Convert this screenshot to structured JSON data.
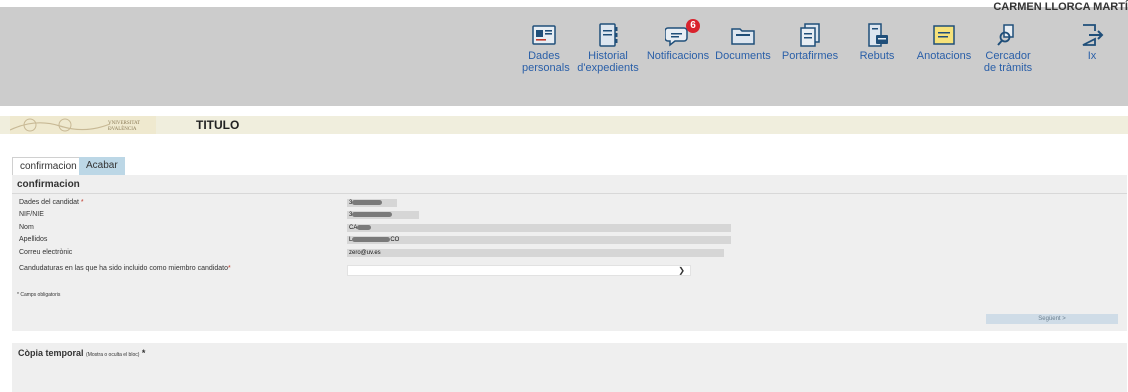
{
  "header": {
    "user_name": "CARMEN LLORCA MARTÍ",
    "nav": [
      {
        "key": "dades",
        "label1": "Dades",
        "label2": "personals",
        "icon": "id-card-icon"
      },
      {
        "key": "historial",
        "label1": "Historial",
        "label2": "d'expedients",
        "icon": "notebook-icon"
      },
      {
        "key": "notificacions",
        "label1": "Notificacions",
        "label2": "",
        "icon": "chat-bubble-icon",
        "badge": "6"
      },
      {
        "key": "documents",
        "label1": "Documents",
        "label2": "",
        "icon": "folder-icon"
      },
      {
        "key": "portafirmes",
        "label1": "Portafirmes",
        "label2": "",
        "icon": "document-stack-icon"
      },
      {
        "key": "rebuts",
        "label1": "Rebuts",
        "label2": "",
        "icon": "receipt-icon"
      },
      {
        "key": "anotacions",
        "label1": "Anotacions",
        "label2": "",
        "icon": "note-icon"
      },
      {
        "key": "cercador",
        "label1": "Cercador",
        "label2": "de tràmits",
        "icon": "search-document-icon"
      },
      {
        "key": "ix",
        "label1": "Ix",
        "label2": "",
        "icon": "exit-icon"
      }
    ]
  },
  "titlebar": {
    "logo_text": "UNIVERSITAT DE VALÈNCIA",
    "title": "TITULO"
  },
  "tabs": [
    {
      "label": "confirmacion"
    },
    {
      "label": "Acabar"
    }
  ],
  "form": {
    "section_title": "confirmacion",
    "fields": [
      {
        "label": "Dades del candidat",
        "required_mark": "*",
        "value": "3"
      },
      {
        "label": "NIF/NIE",
        "value": "3"
      },
      {
        "label": "Nom",
        "value": "CA"
      },
      {
        "label": "Apellidos",
        "value": "L",
        "value_tail": "CO"
      },
      {
        "label": "Correu electrònic",
        "value": "zero@uv.es"
      }
    ],
    "select": {
      "label": "Candudaturas en las que ha sido incluido como miembro candidato",
      "required_mark": "*",
      "value": ""
    },
    "required_note": "* Camps obligatoris",
    "next_button": "Següent >"
  },
  "temp": {
    "title": "Còpia temporal",
    "hint": "(Mostra o oculta el bloc)",
    "required_mark": "*"
  },
  "colors": {
    "header_bg": "#cccccc",
    "link": "#2a5fa8",
    "badge": "#d9232d",
    "titlebar_bg": "#f0eedd",
    "tab_inactive": "#bcd7e6",
    "panel_bg": "#efefef"
  }
}
